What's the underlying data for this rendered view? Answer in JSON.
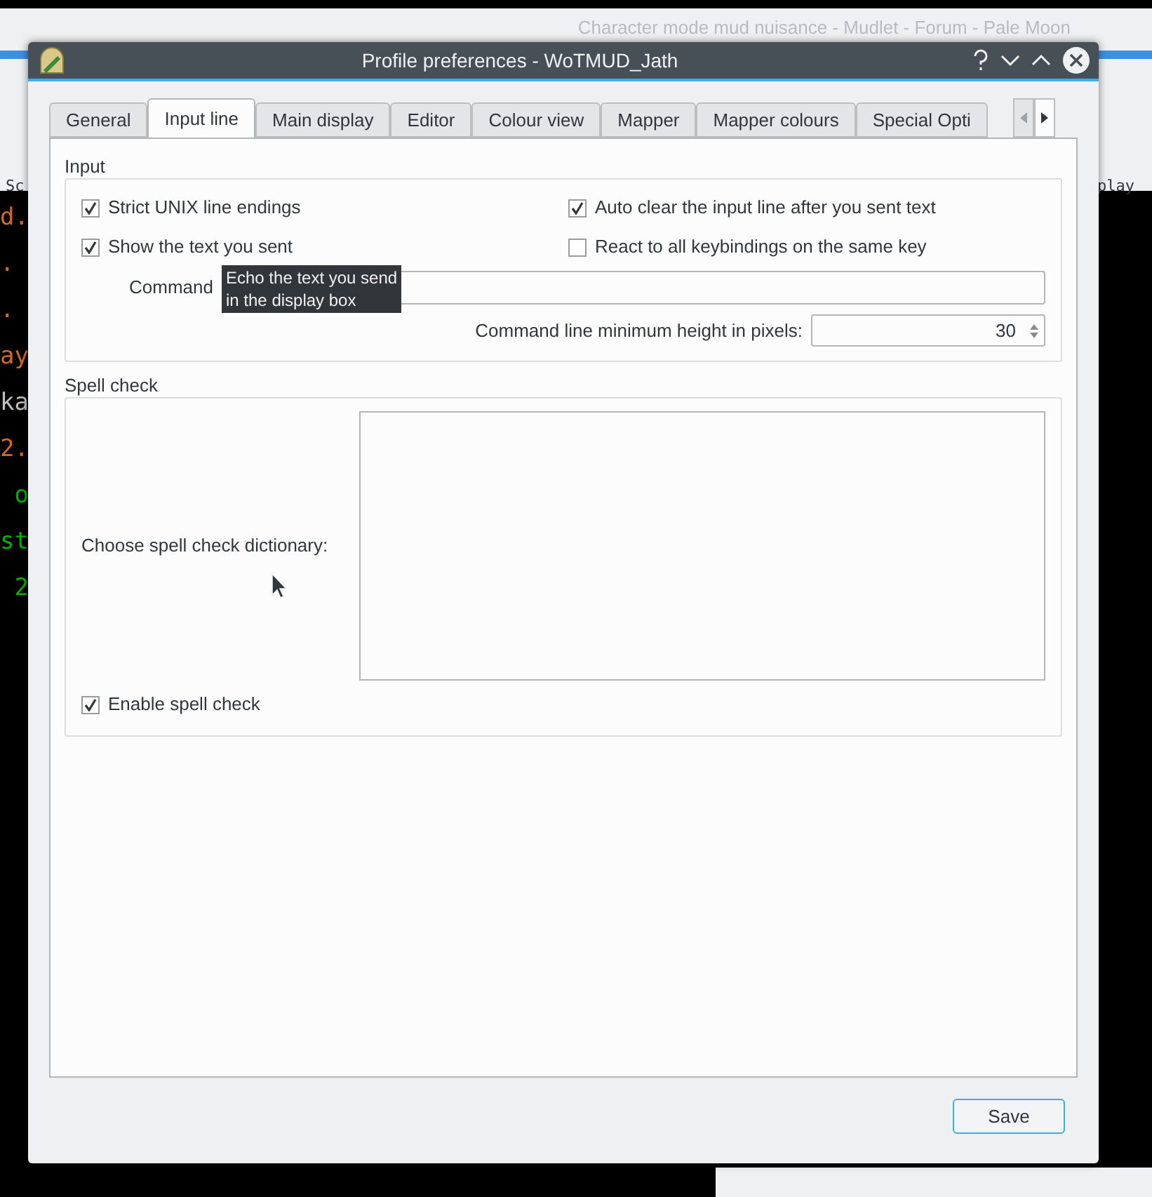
{
  "background": {
    "browser_title": "Character mode mud nuisance - Mudlet - Forum - Pale Moon",
    "toolbar_left": "Sc",
    "toolbar_right": "play",
    "terminal_lines": [
      {
        "text": "d.",
        "color": "#d2691e"
      },
      {
        "text": ".",
        "color": "#d2691e"
      },
      {
        "text": ".",
        "color": "#d2691e"
      },
      {
        "text": "ay",
        "color": "#d2691e"
      },
      {
        "text": "ka",
        "color": "#c0c0c0"
      },
      {
        "text": "2.",
        "color": "#d2691e"
      },
      {
        "text": " o",
        "color": "#00b000"
      },
      {
        "text": "st",
        "color": "#00b000"
      },
      {
        "text": " 2",
        "color": "#00b000"
      }
    ]
  },
  "window": {
    "title": "Profile preferences - WoTMUD_Jath"
  },
  "tabs": [
    {
      "label": "General",
      "selected": false
    },
    {
      "label": "Input line",
      "selected": true
    },
    {
      "label": "Main display",
      "selected": false
    },
    {
      "label": "Editor",
      "selected": false
    },
    {
      "label": "Colour view",
      "selected": false
    },
    {
      "label": "Mapper",
      "selected": false
    },
    {
      "label": "Mapper colours",
      "selected": false
    },
    {
      "label": "Special Opti",
      "selected": false
    }
  ],
  "input_group": {
    "title": "Input",
    "options": [
      {
        "label": "Strict UNIX line endings",
        "checked": true
      },
      {
        "label": "Auto clear the input line after you sent text",
        "checked": true
      },
      {
        "label": "Show the text you sent",
        "checked": true
      },
      {
        "label": "React to all keybindings on the same key",
        "checked": false
      }
    ],
    "command_label": "Command",
    "min_height_label": "Command line minimum height in pixels:",
    "min_height_value": "30"
  },
  "tooltip": {
    "lines": [
      "Echo the text you send",
      "in the display box"
    ]
  },
  "spell_group": {
    "title": "Spell check",
    "dictionary_label": "Choose spell check dictionary:",
    "enable": {
      "label": "Enable spell check",
      "checked": true
    }
  },
  "buttons": [
    "Save"
  ]
}
